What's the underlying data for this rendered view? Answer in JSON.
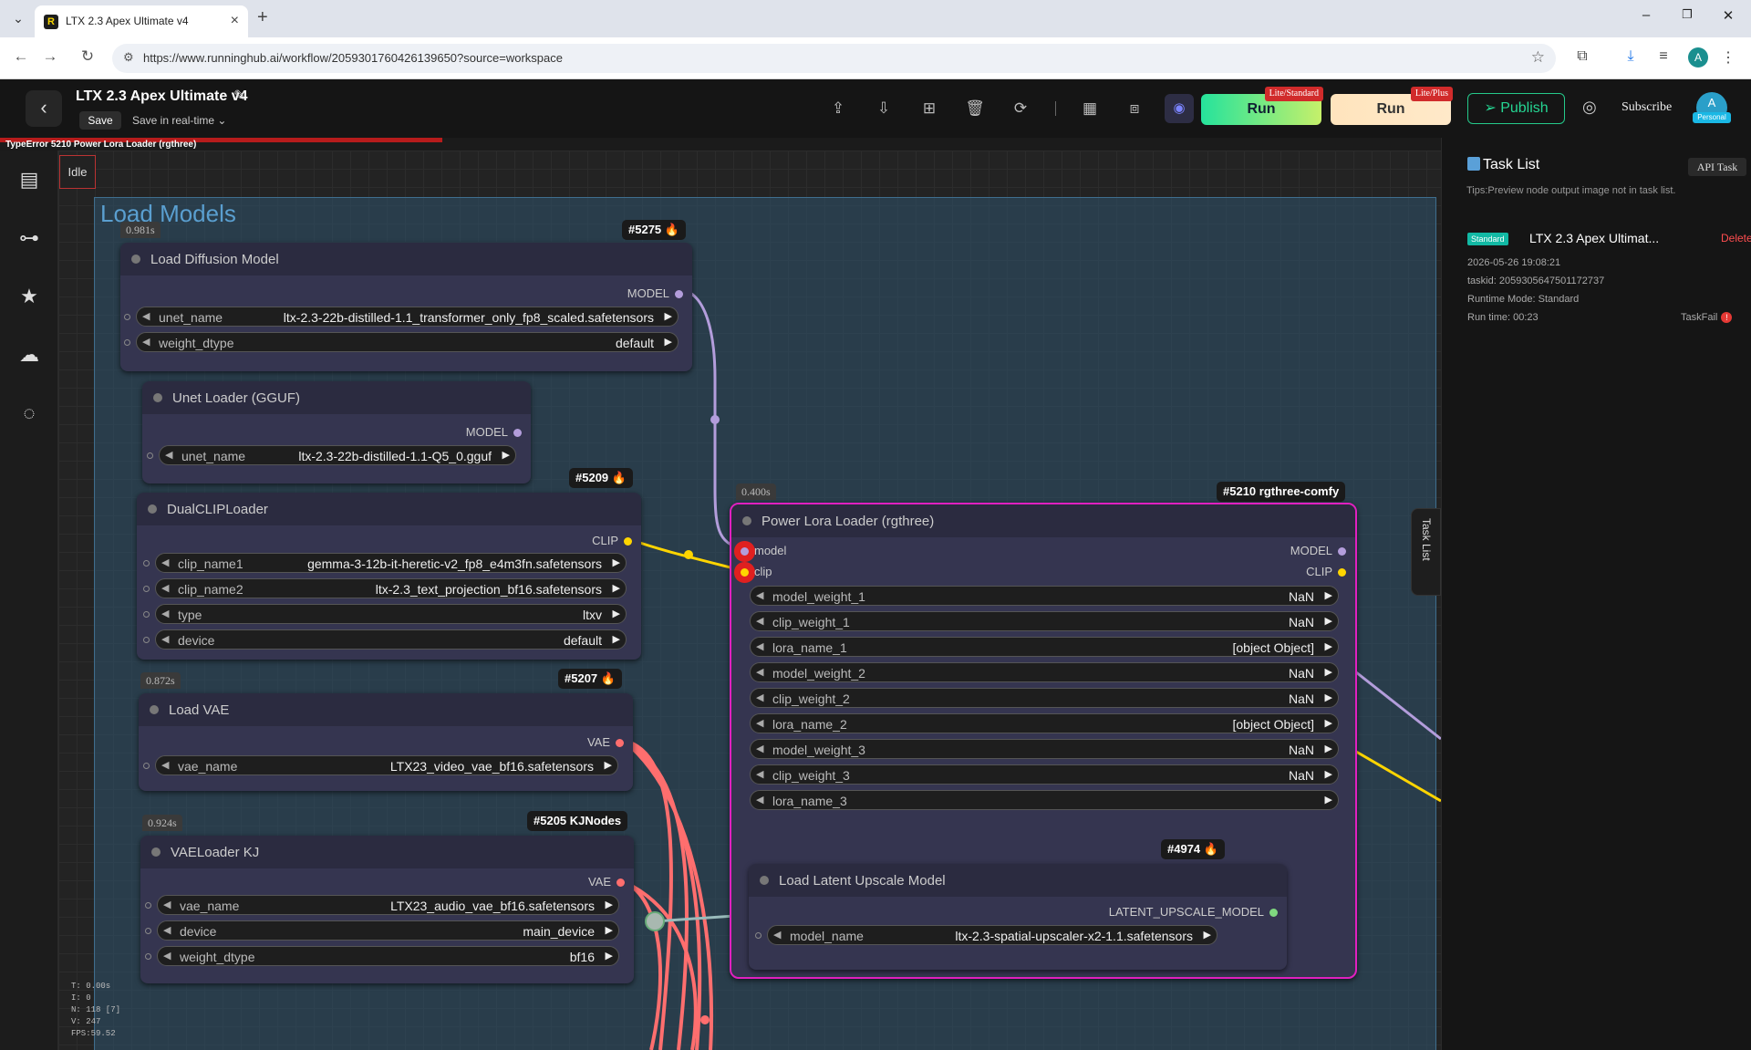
{
  "browser": {
    "tab_title": "LTX 2.3 Apex Ultimate v4",
    "tab_favicon": "R",
    "url": "https://www.runninghub.ai/workflow/2059301760426139650?source=workspace",
    "profile_initial": "A"
  },
  "header": {
    "title": "LTX 2.3 Apex Ultimate v4",
    "save_label": "Save",
    "realtime_label": "Save in real-time",
    "run1_label": "Run",
    "run1_tag": "Lite/Standard",
    "run2_label": "Run",
    "run2_tag": "Lite/Plus",
    "publish_label": "Publish",
    "subscribe_label": "Subscribe",
    "avatar_initial": "A",
    "avatar_tag": "Personal"
  },
  "error": {
    "message": "TypeError 5210 Power Lora Loader (rgthree)"
  },
  "canvas": {
    "status": "Idle",
    "group_title": "Load Models",
    "stats": [
      "T: 0.00s",
      "I: 0",
      "N: 118 [7]",
      "V: 247",
      "FPS:59.52"
    ]
  },
  "nodes": {
    "diffusion": {
      "title": "Load Diffusion Model",
      "time": "0.981s",
      "badge": "#5275",
      "output": "MODEL",
      "w1_label": "unet_name",
      "w1_value": "ltx-2.3-22b-distilled-1.1_transformer_only_fp8_scaled.safetensors",
      "w2_label": "weight_dtype",
      "w2_value": "default"
    },
    "gguf": {
      "title": "Unet Loader (GGUF)",
      "output": "MODEL",
      "w1_label": "unet_name",
      "w1_value": "ltx-2.3-22b-distilled-1.1-Q5_0.gguf"
    },
    "dualclip": {
      "title": "DualCLIPLoader",
      "badge": "#5209",
      "output": "CLIP",
      "w1_label": "clip_name1",
      "w1_value": "gemma-3-12b-it-heretic-v2_fp8_e4m3fn.safetensors",
      "w2_label": "clip_name2",
      "w2_value": "ltx-2.3_text_projection_bf16.safetensors",
      "w3_label": "type",
      "w3_value": "ltxv",
      "w4_label": "device",
      "w4_value": "default"
    },
    "vae": {
      "title": "Load VAE",
      "time": "0.872s",
      "badge": "#5207",
      "output": "VAE",
      "w1_label": "vae_name",
      "w1_value": "LTX23_video_vae_bf16.safetensors"
    },
    "vaekj": {
      "title": "VAELoader KJ",
      "time": "0.924s",
      "badge": "#5205 KJNodes",
      "output": "VAE",
      "w1_label": "vae_name",
      "w1_value": "LTX23_audio_vae_bf16.safetensors",
      "w2_label": "device",
      "w2_value": "main_device",
      "w3_label": "weight_dtype",
      "w3_value": "bf16"
    },
    "lora": {
      "title": "Power Lora Loader (rgthree)",
      "time": "0.400s",
      "badge": "#5210 rgthree-comfy",
      "in1": "model",
      "in2": "clip",
      "out1": "MODEL",
      "out2": "CLIP",
      "widgets": [
        {
          "label": "model_weight_1",
          "value": "NaN"
        },
        {
          "label": "clip_weight_1",
          "value": "NaN"
        },
        {
          "label": "lora_name_1",
          "value": "[object Object]"
        },
        {
          "label": "model_weight_2",
          "value": "NaN"
        },
        {
          "label": "clip_weight_2",
          "value": "NaN"
        },
        {
          "label": "lora_name_2",
          "value": "[object Object]"
        },
        {
          "label": "model_weight_3",
          "value": "NaN"
        },
        {
          "label": "clip_weight_3",
          "value": "NaN"
        },
        {
          "label": "lora_name_3",
          "value": ""
        }
      ]
    },
    "upscale": {
      "title": "Load Latent Upscale Model",
      "badge": "#4974",
      "output": "LATENT_UPSCALE_MODEL",
      "w1_label": "model_name",
      "w1_value": "ltx-2.3-spatial-upscaler-x2-1.1.safetensors"
    }
  },
  "task_panel": {
    "title": "Task List",
    "api_label": "API Task",
    "tips": "Tips:Preview node output image not in task list.",
    "tag": "Standard",
    "task_name": "LTX 2.3 Apex Ultimat...",
    "delete_label": "Delete",
    "date": "2026-05-26 19:08:21",
    "taskid": "taskid: 2059305647501172737",
    "mode": "Runtime Mode: Standard",
    "runtime": "Run time: 00:23",
    "status": "TaskFail",
    "side_tab": "Task List"
  },
  "colors": {
    "model_link": "#b39ddb",
    "clip_link": "#ffd500",
    "vae_link": "#ff6e6e",
    "lora_border": "#e020c0",
    "accent_green": "#25d693",
    "error_red": "#b71c1c"
  }
}
